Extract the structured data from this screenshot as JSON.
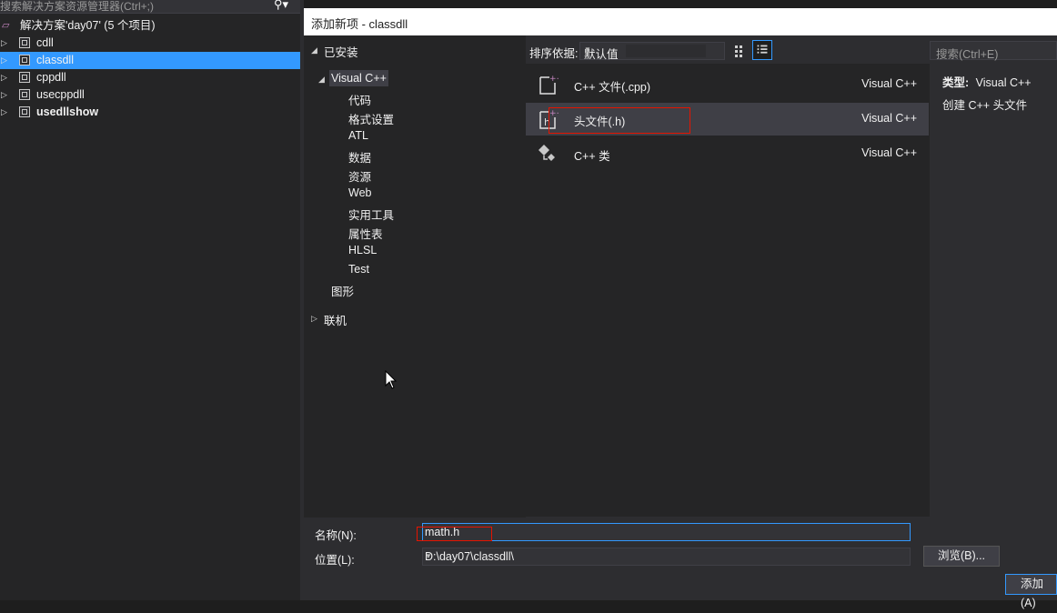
{
  "solution_explorer": {
    "search_placeholder": "搜索解决方案资源管理器(Ctrl+;)",
    "solution_label": "解决方案'day07' (5 个项目)",
    "projects": [
      {
        "label": "cdll",
        "selected": false,
        "bold": false
      },
      {
        "label": "classdll",
        "selected": true,
        "bold": false
      },
      {
        "label": "cppdll",
        "selected": false,
        "bold": false
      },
      {
        "label": "usecppdll",
        "selected": false,
        "bold": false
      },
      {
        "label": "usedllshow",
        "selected": false,
        "bold": true
      }
    ]
  },
  "dialog": {
    "title": "添加新项 - classdll",
    "installed_label": "已安装",
    "category_root": "Visual C++",
    "subcategories": [
      "代码",
      "格式设置",
      "ATL",
      "数据",
      "资源",
      "Web",
      "实用工具",
      "属性表",
      "HLSL",
      "Test"
    ],
    "graphics_label": "图形",
    "online_label": "联机",
    "sort_label": "排序依据:",
    "sort_value": "默认值",
    "search_placeholder": "搜索(Ctrl+E)",
    "templates": [
      {
        "name": "C++ 文件(.cpp)",
        "language": "Visual C++",
        "icon": "cpp-file-icon",
        "selected": false
      },
      {
        "name": "头文件(.h)",
        "language": "Visual C++",
        "icon": "header-file-icon",
        "selected": true
      },
      {
        "name": "C++ 类",
        "language": "Visual C++",
        "icon": "cpp-class-icon",
        "selected": false
      }
    ],
    "type_label": "类型:",
    "type_value": "Visual C++",
    "description": "创建 C++ 头文件",
    "name_label": "名称(N):",
    "name_value": "math.h",
    "location_label": "位置(L):",
    "location_value": "D:\\day07\\classdll\\",
    "browse_button": "浏览(B)...",
    "add_button": "添加(A)"
  },
  "colors": {
    "accent": "#3399ff",
    "highlight_box": "#e51400",
    "plus_marker": "#c586c0"
  }
}
